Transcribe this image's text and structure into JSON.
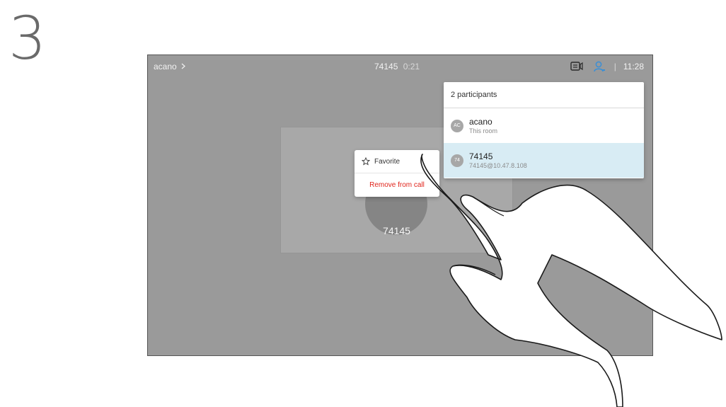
{
  "step": {
    "number": "3"
  },
  "call": {
    "name": "acano",
    "chevron": ">",
    "number": "74145",
    "duration": "0:21",
    "clock": "11:28",
    "divider": "|",
    "icons": {
      "layout": "layout-icon",
      "participants": "participants-icon",
      "chevron": "chevron-right-icon"
    }
  },
  "tile": {
    "label": "74145"
  },
  "participants_panel": {
    "title": "2 participants",
    "items": [
      {
        "initials": "AC",
        "name": "acano",
        "subtitle": "This room"
      },
      {
        "initials": "74",
        "name": "74145",
        "subtitle": "74145@10.47.8.108"
      }
    ]
  },
  "context_menu": {
    "favorite_label": "Favorite",
    "remove_label": "Remove from call",
    "icons": {
      "favorite": "star-icon"
    }
  },
  "colors": {
    "screen_bg": "#9a9a9a",
    "selected_row": "#d8ecf4",
    "accent": "#3a8fd6",
    "danger": "#e0241b"
  }
}
